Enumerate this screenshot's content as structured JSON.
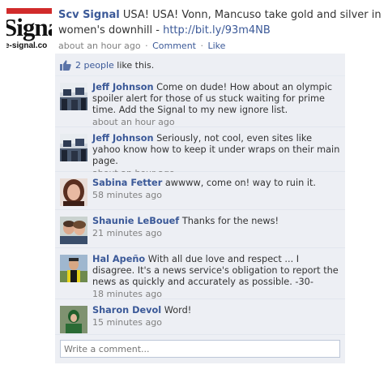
{
  "post": {
    "author": "Scv Signal",
    "text": "USA! USA! Vonn, Mancuso take gold and silver in women's downhill -",
    "link": "http://bit.ly/93m4NB",
    "time": "about an hour ago",
    "comment_action": "Comment",
    "like_action": "Like",
    "separator": "·",
    "logo_text": "Signal",
    "logo_sub": "e-signal.co"
  },
  "likes": {
    "people": "2 people",
    "suffix": "like this."
  },
  "comments": [
    {
      "author": "Jeff Johnson",
      "text": "Come on dude! How about an olympic spoiler alert for those of us stuck waiting for prime time. Add the Signal to my new ignore list.",
      "time": "about an hour ago"
    },
    {
      "author": "Jeff Johnson",
      "text": "Seriously, not cool, even sites like yahoo know how to keep it under wraps on their main page.",
      "time": "about an hour ago"
    },
    {
      "author": "Sabina Fetter",
      "text": "awwww, come on! way to ruin it.",
      "time": "58 minutes ago"
    },
    {
      "author": "Shaunie LeBouef",
      "text": "Thanks for the news!",
      "time": "21 minutes ago"
    },
    {
      "author": "Hal Apeño",
      "text": "With all due love and respect ... I disagree. It's a news service's obligation to report the news as quickly and accurately as possible. -30-",
      "time": "18 minutes ago"
    },
    {
      "author": "Sharon Devol",
      "text": "Word!",
      "time": "15 minutes ago"
    }
  ],
  "write_placeholder": "Write a comment...",
  "colors": {
    "link": "#3b5998",
    "panel": "#edeff4",
    "meta": "#808080"
  }
}
